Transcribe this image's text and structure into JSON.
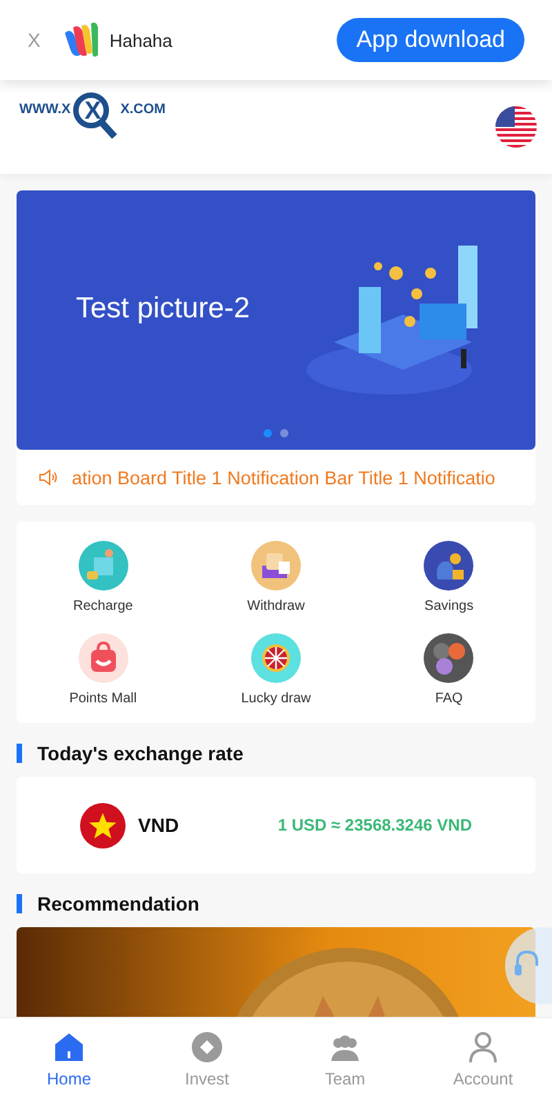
{
  "download_bar": {
    "close": "X",
    "app_name": "Hahaha",
    "button": "App download"
  },
  "header": {
    "logo": [
      "WWW.X",
      "X",
      "X.COM"
    ]
  },
  "banner": {
    "caption": "Test picture-2",
    "dots": [
      {
        "selected": true
      },
      {
        "selected": false
      }
    ]
  },
  "notice": {
    "text": "ation Board Title 1 Notification Bar Title 1 Notificatio"
  },
  "shortcuts": [
    {
      "label": "Recharge",
      "kind": "recharge"
    },
    {
      "label": "Withdraw",
      "kind": "withdraw"
    },
    {
      "label": "Savings",
      "kind": "savings"
    },
    {
      "label": "Points Mall",
      "kind": "mall"
    },
    {
      "label": "Lucky draw",
      "kind": "lucky"
    },
    {
      "label": "FAQ",
      "kind": "faq"
    }
  ],
  "exchange": {
    "title": "Today's exchange rate",
    "currency": "VND",
    "rate": "1 USD ≈ 23568.3246 VND"
  },
  "recommendation": {
    "title": "Recommendation"
  },
  "nav": [
    {
      "label": "Home",
      "kind": "home",
      "selected": true
    },
    {
      "label": "Invest",
      "kind": "invest",
      "selected": false
    },
    {
      "label": "Team",
      "kind": "team",
      "selected": false
    },
    {
      "label": "Account",
      "kind": "account",
      "selected": false
    }
  ]
}
